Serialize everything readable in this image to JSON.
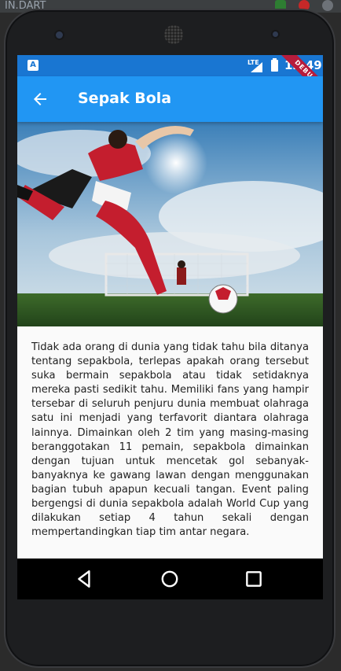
{
  "ide": {
    "tab_text": "IN.DART"
  },
  "status_bar": {
    "network": "LTE",
    "time": "12:49",
    "app_badge": "A"
  },
  "debug_banner": "DEBUG",
  "app_bar": {
    "title": "Sepak Bola",
    "back_icon": "arrow-back-icon"
  },
  "hero_image": {
    "subject": "football-kick-photo"
  },
  "article": {
    "text": "Tidak ada orang di dunia yang tidak tahu bila ditanya tentang sepakbola, terlepas apakah orang tersebut suka bermain sepakbola atau tidak setidaknya mereka pasti sedikit tahu. Memiliki fans yang hampir tersebar di seluruh penjuru dunia membuat olahraga satu ini menjadi yang terfavorit diantara olahraga lainnya. Dimainkan oleh 2 tim yang masing-masing beranggotakan 11 pemain, sepakbola dimainkan dengan tujuan untuk mencetak gol sebanyak-banyaknya ke gawang lawan dengan menggunakan bagian tubuh apapun kecuali tangan. Event paling bergengsi di dunia sepakbola adalah World Cup yang dilakukan setiap 4 tahun sekali dengan mempertandingkan tiap tim antar negara."
  },
  "nav_bar": {
    "back": "triangle-back-icon",
    "home": "circle-home-icon",
    "recents": "square-recents-icon"
  },
  "colors": {
    "status_bar": "#1976d2",
    "app_bar": "#2196f3",
    "debug": "#b71c3c",
    "nav_bar": "#000000"
  }
}
